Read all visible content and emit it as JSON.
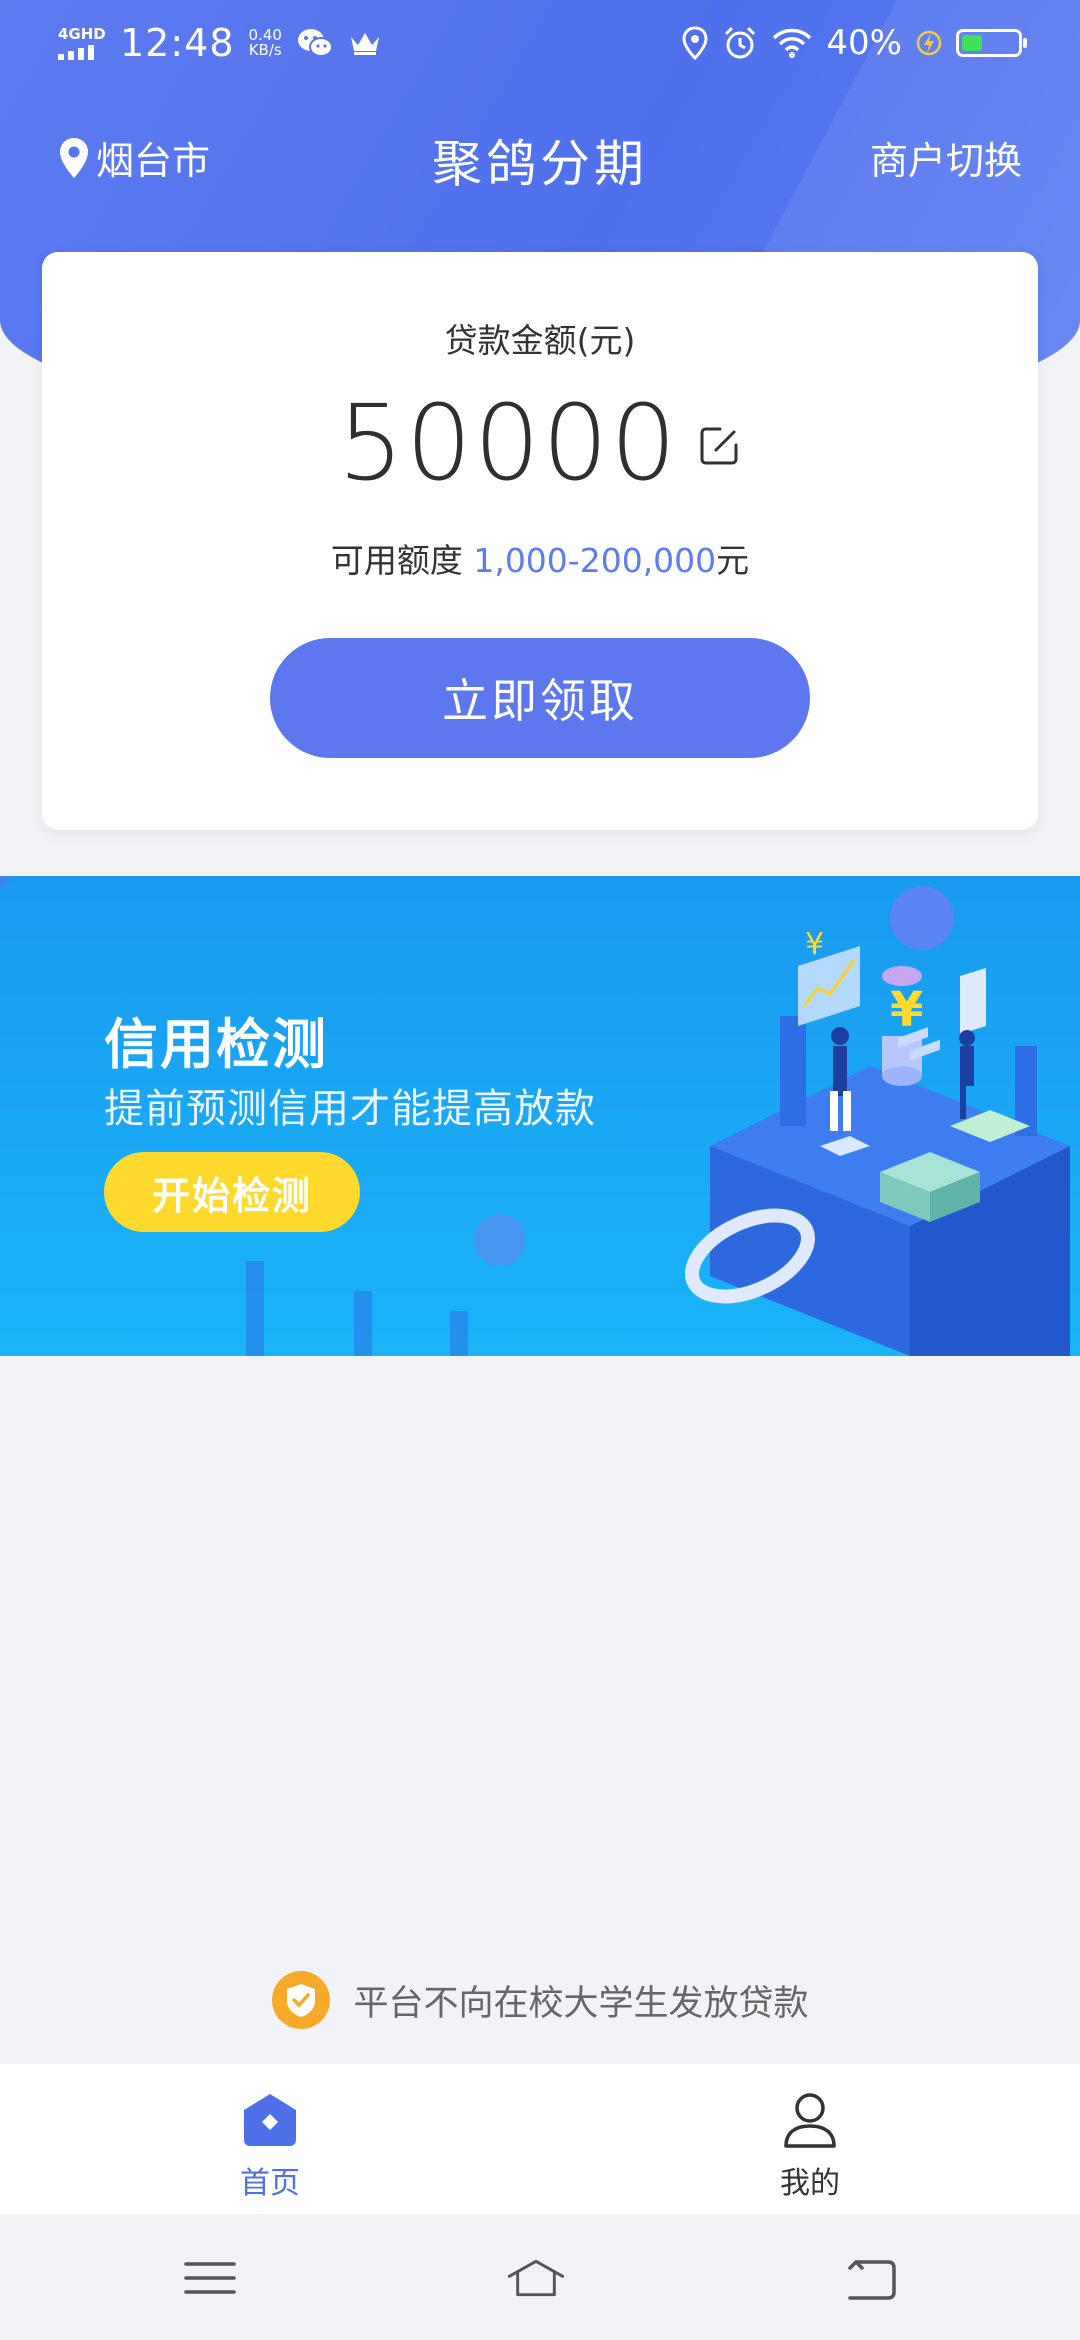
{
  "status_bar": {
    "network": "4GHD",
    "time": "12:48",
    "speed_value": "0.40",
    "speed_unit": "KB/s",
    "battery": "40%",
    "icons": [
      "wechat-icon",
      "crown-icon",
      "location-icon",
      "alarm-icon",
      "wifi-icon",
      "charging-icon",
      "battery-icon"
    ],
    "battery_level": 0.4
  },
  "header": {
    "city": "烟台市",
    "title": "聚鸽分期",
    "merchant_switch": "商户切换"
  },
  "loan_card": {
    "label": "贷款金额(元)",
    "amount": "50000",
    "range_prefix": "可用额度 ",
    "range_value": "1,000-200,000",
    "range_suffix": "元",
    "button": "立即领取"
  },
  "banner": {
    "title": "信用检测",
    "subtitle": "提前预测信用才能提高放款",
    "button": "开始检测"
  },
  "notice": {
    "text": "平台不向在校大学生发放贷款"
  },
  "tab_bar": {
    "home": "首页",
    "mine": "我的"
  },
  "colors": {
    "primary": "#5d78ee",
    "banner_blue": "#1aa6f3",
    "banner_button": "#ffd92b",
    "notice_shield": "#f7a92a",
    "tab_active": "#4f6fe8"
  }
}
